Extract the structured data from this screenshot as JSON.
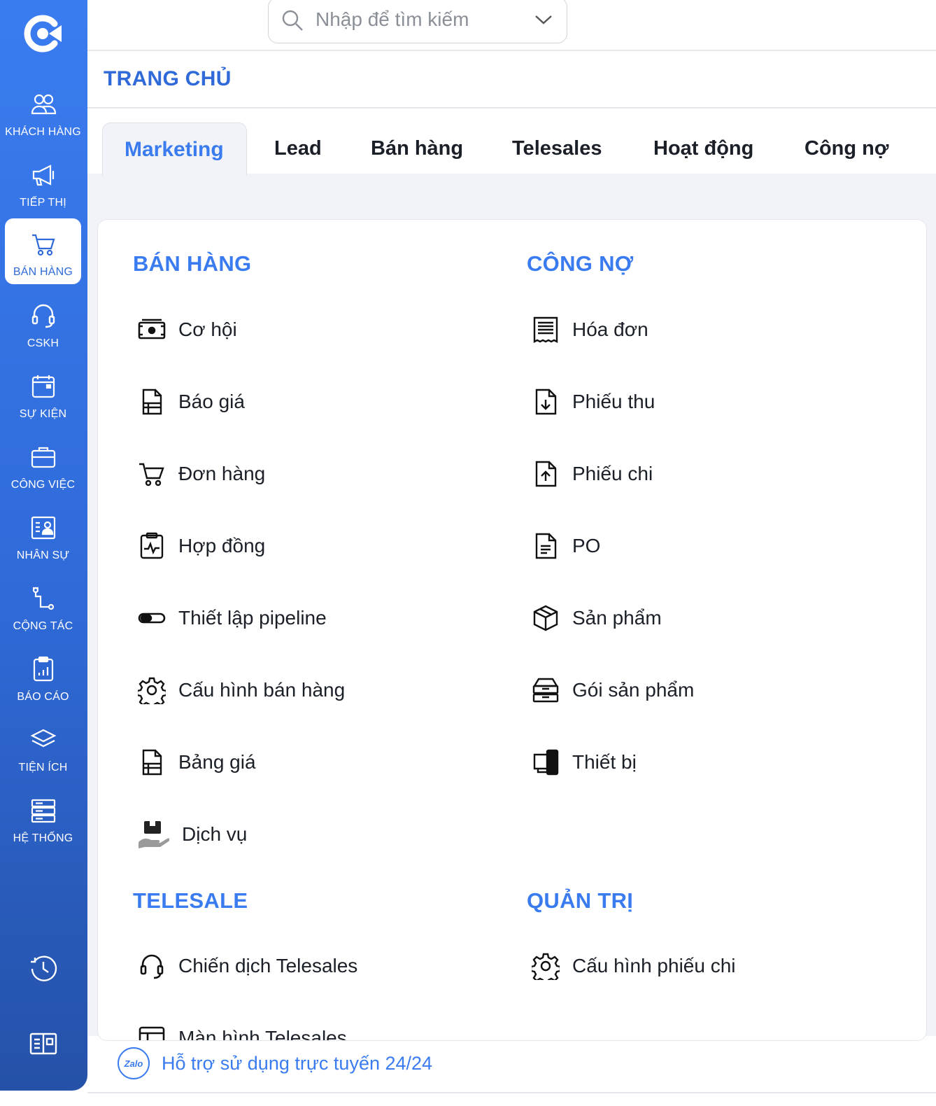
{
  "search": {
    "placeholder": "Nhập để tìm kiếm"
  },
  "page": {
    "title": "TRANG CHỦ"
  },
  "sidebar": {
    "items": [
      {
        "label": "KHÁCH HÀNG",
        "icon": "users-icon"
      },
      {
        "label": "TIẾP THỊ",
        "icon": "megaphone-icon"
      },
      {
        "label": "BÁN HÀNG",
        "icon": "cart-icon",
        "active": true
      },
      {
        "label": "CSKH",
        "icon": "headset-icon"
      },
      {
        "label": "SỰ KIỆN",
        "icon": "calendar-icon"
      },
      {
        "label": "CÔNG VIỆC",
        "icon": "briefcase-icon"
      },
      {
        "label": "NHÂN SỰ",
        "icon": "id-card-icon"
      },
      {
        "label": "CỘNG TÁC",
        "icon": "route-icon"
      },
      {
        "label": "BÁO CÁO",
        "icon": "report-icon"
      },
      {
        "label": "TIỆN ÍCH",
        "icon": "layers-icon"
      },
      {
        "label": "HỆ THỐNG",
        "icon": "server-icon"
      }
    ]
  },
  "tabs": [
    "Marketing",
    "Lead",
    "Bán hàng",
    "Telesales",
    "Hoạt động",
    "Công nợ"
  ],
  "sections": {
    "ban_hang": {
      "title": "BÁN HÀNG",
      "items": [
        "Cơ hội",
        "Báo giá",
        "Đơn hàng",
        "Hợp đồng",
        "Thiết lập pipeline",
        "Cấu hình bán hàng",
        "Bảng giá",
        "Dịch vụ"
      ]
    },
    "cong_no": {
      "title": "CÔNG NỢ",
      "items": [
        "Hóa đơn",
        "Phiếu thu",
        "Phiếu chi",
        "PO",
        "Sản phẩm",
        "Gói sản phẩm",
        "Thiết bị"
      ]
    },
    "telesale": {
      "title": "TELESALE",
      "items": [
        "Chiến dịch Telesales",
        "Màn hình Telesales"
      ]
    },
    "quan_tri": {
      "title": "QUẢN TRỊ",
      "items": [
        "Cấu hình phiếu chi"
      ]
    }
  },
  "footer": {
    "zalo_text": "Zalo",
    "support": "Hỗ trợ sử dụng trực tuyến 24/24"
  },
  "colors": {
    "primary": "#3a7cf0",
    "sidebar": "#2f6ad8",
    "text": "#1b1f27"
  }
}
